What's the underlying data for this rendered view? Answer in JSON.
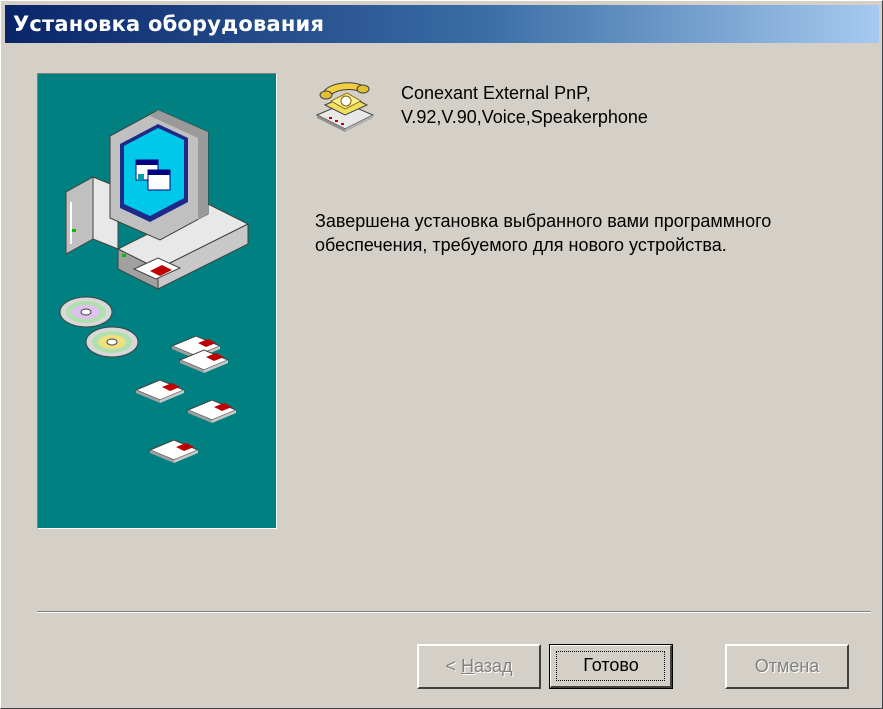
{
  "window": {
    "title": "Установка оборудования"
  },
  "device": {
    "icon": "modem-phone-icon",
    "name_line1": "Conexant External PnP,",
    "name_line2": "V.92,V.90,Voice,Speakerphone"
  },
  "message": "Завершена установка выбранного вами программного обеспечения, требуемого для нового устройства.",
  "buttons": {
    "back_prefix": "< ",
    "back_access": "Н",
    "back_rest": "азад",
    "finish": "Готово",
    "cancel": "Отмена"
  },
  "colors": {
    "panel_bg": "#008080",
    "title_start": "#0a246a",
    "title_end": "#a6caf0",
    "face": "#d4d0c8"
  }
}
